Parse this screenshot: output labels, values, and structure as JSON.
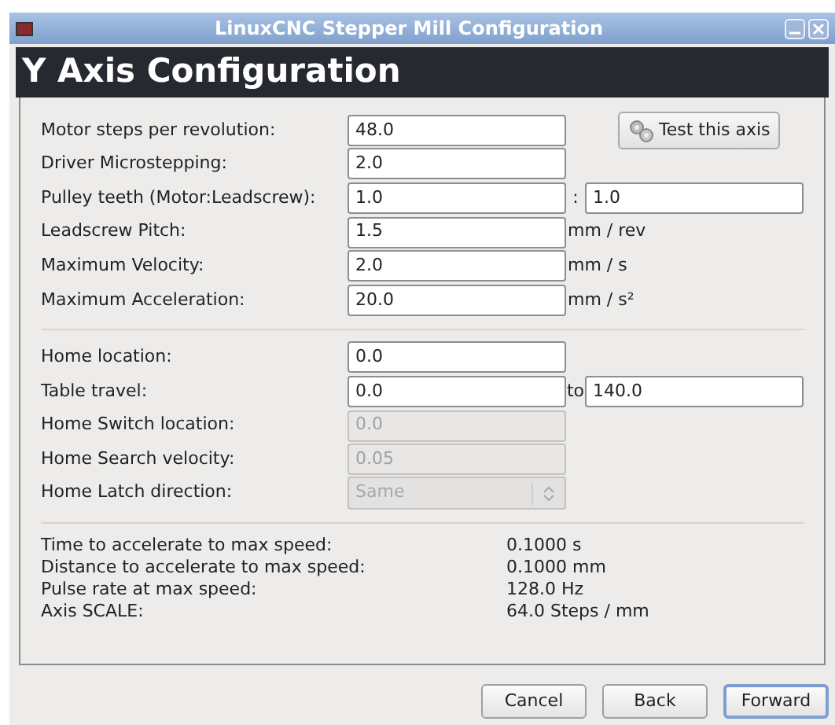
{
  "window": {
    "title": "LinuxCNC Stepper Mill Configuration"
  },
  "header": "Y Axis Configuration",
  "test_button": "Test this axis",
  "motor_rows": [
    {
      "kind": "field",
      "label": "Motor steps per revolution:",
      "value": "48.0",
      "disabled": false
    },
    {
      "kind": "field",
      "label": "Driver Microstepping:",
      "value": "2.0",
      "disabled": false
    },
    {
      "kind": "pair",
      "label": "Pulley teeth (Motor:Leadscrew):",
      "value": "1.0",
      "separator": ":",
      "value2": "1.0",
      "disabled": false
    },
    {
      "kind": "field",
      "label": "Leadscrew Pitch:",
      "value": "1.5",
      "unit": "mm / rev",
      "disabled": false
    },
    {
      "kind": "field",
      "label": "Maximum Velocity:",
      "value": "2.0",
      "unit": "mm / s",
      "disabled": false
    },
    {
      "kind": "field",
      "label": "Maximum Acceleration:",
      "value": "20.0",
      "unit": "mm / s²",
      "disabled": false
    }
  ],
  "home_rows": [
    {
      "kind": "field",
      "label": "Home location:",
      "value": "0.0",
      "disabled": false
    },
    {
      "kind": "pair",
      "label": "Table travel:",
      "value": "0.0",
      "separator": "to",
      "value2": "140.0",
      "disabled": false
    },
    {
      "kind": "field",
      "label": "Home Switch location:",
      "value": "0.0",
      "disabled": true
    },
    {
      "kind": "field",
      "label": "Home Search velocity:",
      "value": "0.05",
      "disabled": true
    },
    {
      "kind": "select",
      "label": "Home Latch direction:",
      "value": "Same",
      "disabled": true
    }
  ],
  "info_rows": [
    {
      "label": "Time to accelerate to max speed:",
      "value": "0.1000 s"
    },
    {
      "label": "Distance to accelerate to max speed:",
      "value": "0.1000 mm"
    },
    {
      "label": "Pulse rate at max speed:",
      "value": "128.0 Hz"
    },
    {
      "label": "Axis SCALE:",
      "value": "64.0 Steps / mm"
    }
  ],
  "buttons": [
    {
      "label": "Cancel",
      "selected": false
    },
    {
      "label": "Back",
      "selected": false
    },
    {
      "label": "Forward",
      "selected": true
    }
  ]
}
